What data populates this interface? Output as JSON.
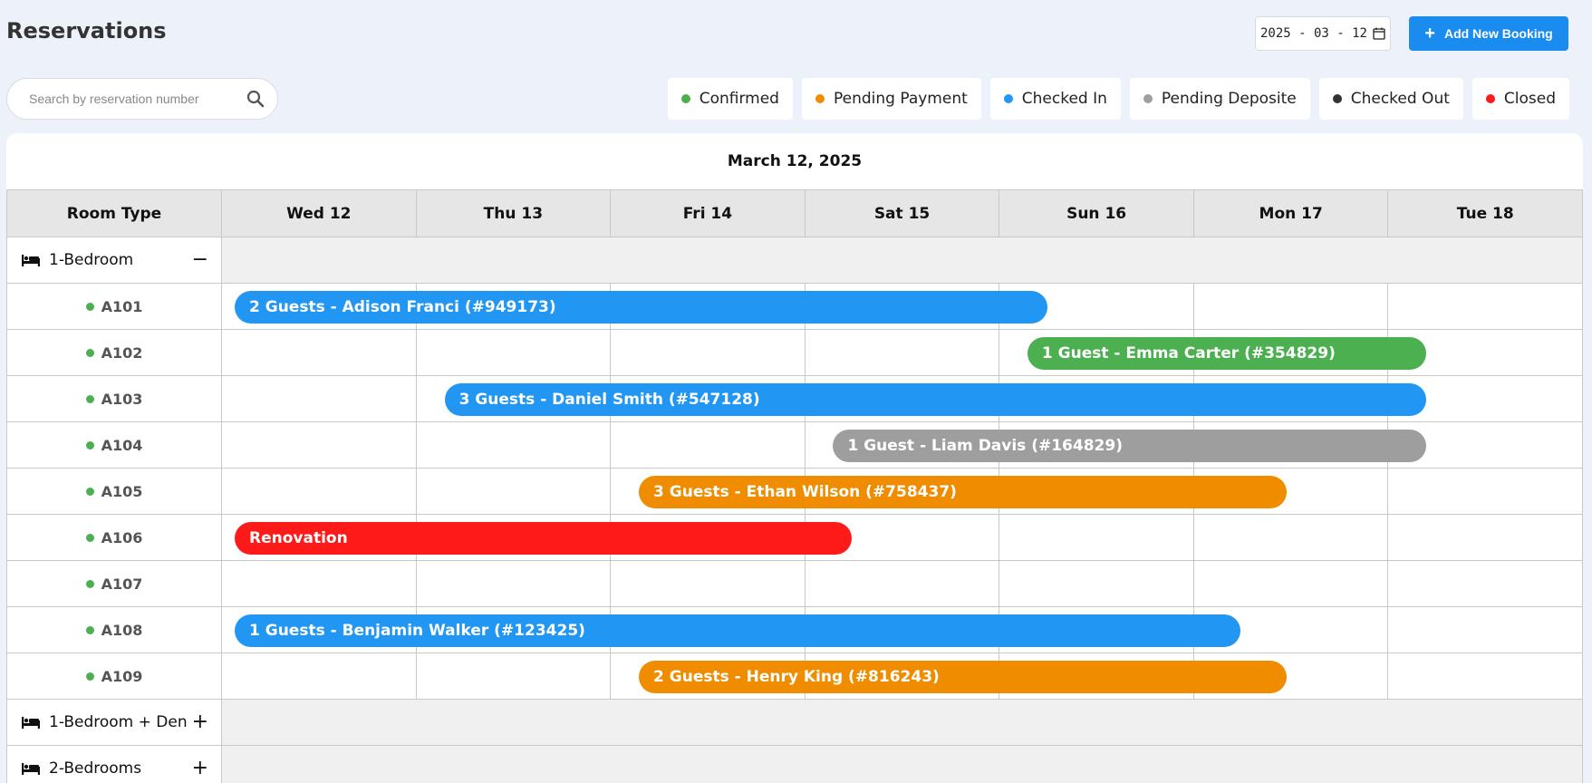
{
  "page": {
    "title": "Reservations"
  },
  "date_picker": {
    "value": "2025 - 03 - 12"
  },
  "add_button": {
    "label": "Add New Booking"
  },
  "search": {
    "placeholder": "Search by reservation number"
  },
  "legend": [
    {
      "label": "Confirmed",
      "color": "#4caf50"
    },
    {
      "label": "Pending Payment",
      "color": "#ef8c00"
    },
    {
      "label": "Checked In",
      "color": "#2196f3"
    },
    {
      "label": "Pending Deposite",
      "color": "#9e9e9e"
    },
    {
      "label": "Checked Out",
      "color": "#333333"
    },
    {
      "label": "Closed",
      "color": "#ff1a1a"
    }
  ],
  "calendar": {
    "date_label": "March 12, 2025",
    "room_type_header": "Room Type",
    "days": [
      "Wed 12",
      "Thu 13",
      "Fri 14",
      "Sat 15",
      "Sun 16",
      "Mon 17",
      "Tue 18"
    ],
    "groups": [
      {
        "name": "1-Bedroom",
        "toggle": "−",
        "expanded": true
      },
      {
        "name": "1-Bedroom + Den",
        "toggle": "+",
        "expanded": false
      },
      {
        "name": "2-Bedrooms",
        "toggle": "+",
        "expanded": false
      }
    ],
    "rooms": [
      "A101",
      "A102",
      "A103",
      "A104",
      "A105",
      "A106",
      "A107",
      "A108",
      "A109"
    ],
    "room_status_color": "#4caf50",
    "bookings": [
      {
        "room": "A101",
        "label": "2 Guests - Adison Franci (#949173)",
        "status": "Checked In",
        "color": "#2196f3",
        "start_day": 0,
        "end_day": 4.25
      },
      {
        "room": "A102",
        "label": "1 Guest - Emma Carter (#354829)",
        "status": "Confirmed",
        "color": "#4caf50",
        "start_day": 4.08,
        "end_day": 6.2
      },
      {
        "room": "A103",
        "label": "3 Guests - Daniel Smith (#547128)",
        "status": "Checked In",
        "color": "#2196f3",
        "start_day": 1.08,
        "end_day": 6.2
      },
      {
        "room": "A104",
        "label": "1 Guest - Liam Davis (#164829)",
        "status": "Pending Deposite",
        "color": "#9e9e9e",
        "start_day": 3.08,
        "end_day": 6.2
      },
      {
        "room": "A105",
        "label": "3 Guests - Ethan Wilson (#758437)",
        "status": "Pending Payment",
        "color": "#ef8c00",
        "start_day": 2.08,
        "end_day": 5.48
      },
      {
        "room": "A106",
        "label": "Renovation",
        "status": "Closed",
        "color": "#ff1a1a",
        "start_day": 0,
        "end_day": 3.24
      },
      {
        "room": "A108",
        "label": "1 Guests - Benjamin Walker (#123425)",
        "status": "Checked In",
        "color": "#2196f3",
        "start_day": 0,
        "end_day": 5.24
      },
      {
        "room": "A109",
        "label": "2 Guests - Henry King (#816243)",
        "status": "Pending Payment",
        "color": "#ef8c00",
        "start_day": 2.08,
        "end_day": 5.48
      }
    ]
  }
}
